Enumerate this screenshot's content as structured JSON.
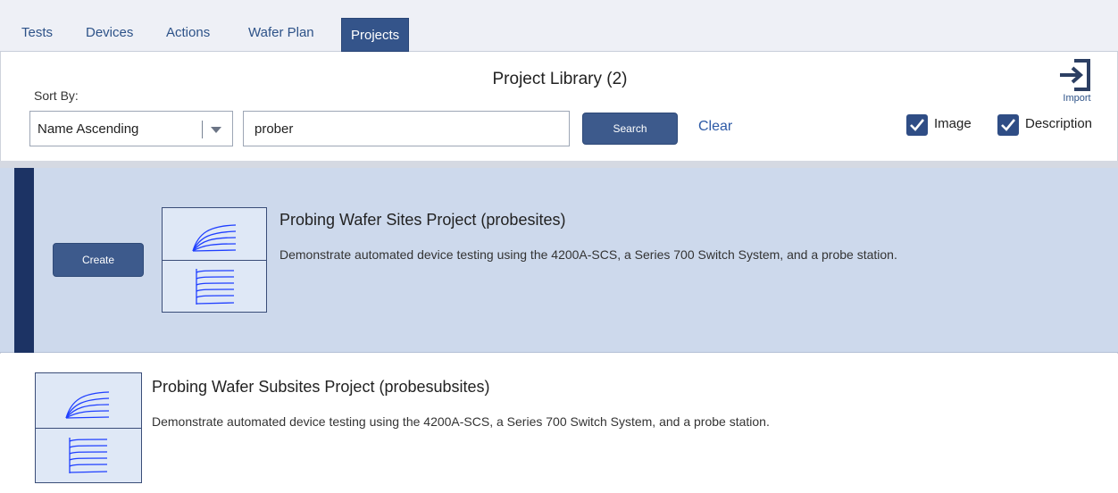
{
  "tabs": [
    {
      "label": "Tests"
    },
    {
      "label": "Devices"
    },
    {
      "label": "Actions"
    },
    {
      "label": "Wafer Plan"
    },
    {
      "label": "Projects",
      "active": true
    }
  ],
  "header": {
    "title": "Project Library (2)",
    "sort_label": "Sort By:",
    "sort_value": "Name Ascending",
    "search_value": "prober",
    "search_button": "Search",
    "clear_link": "Clear",
    "import_label": "Import",
    "checkbox_image": {
      "label": "Image",
      "checked": true
    },
    "checkbox_description": {
      "label": "Description",
      "checked": true
    }
  },
  "projects": [
    {
      "title": "Probing Wafer Sites Project (probesites)",
      "description": "Demonstrate automated device testing using the 4200A-SCS, a Series 700 Switch System, and a probe station.",
      "selected": true,
      "action_button": "Create"
    },
    {
      "title": "Probing Wafer Subsites Project (probesubsites)",
      "description": "Demonstrate automated device testing using the 4200A-SCS, a Series 700 Switch System, and a probe station.",
      "selected": false
    }
  ],
  "icons": {
    "import": "import-icon",
    "checkbox": "checkmark-icon",
    "dropdown": "chevron-down-icon",
    "thumbnail": "iv-curve-icon"
  },
  "colors": {
    "accent": "#34548a",
    "selected_row": "#cdd9ec",
    "selected_bar": "#1c3364",
    "link": "#2d5aa6",
    "curve": "#1f3fff"
  }
}
